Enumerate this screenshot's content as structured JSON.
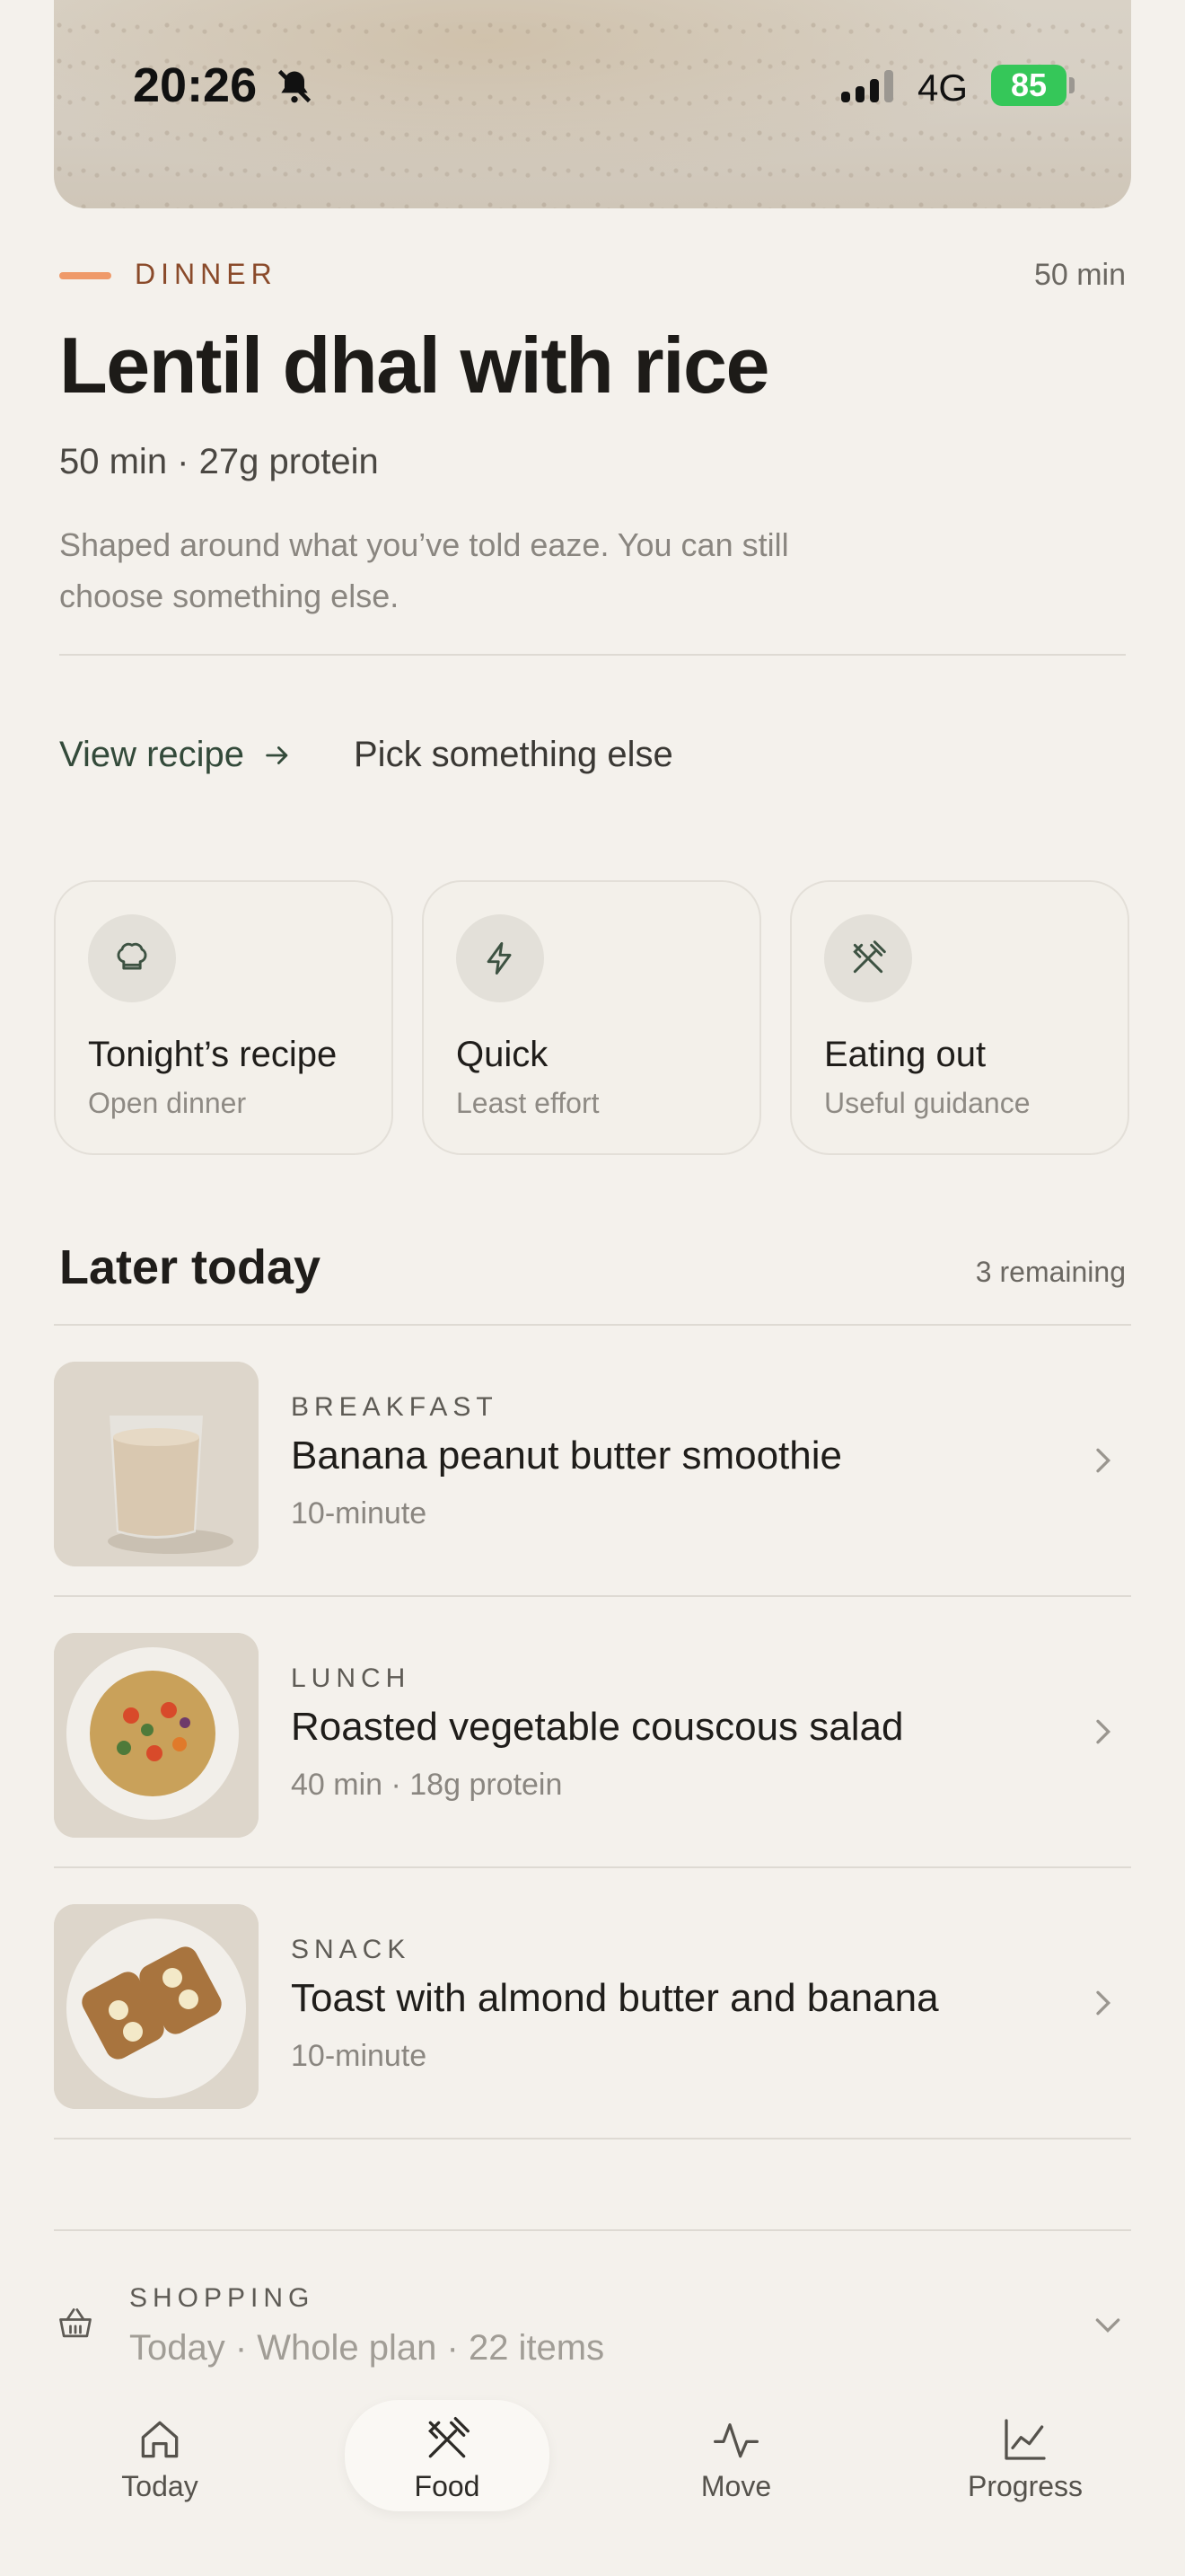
{
  "status_bar": {
    "time": "20:26",
    "network": "4G",
    "battery": "85"
  },
  "dinner": {
    "meal_type": "DINNER",
    "time": "50 min",
    "title": "Lentil dhal with rice",
    "subtitle": "50 min · 27g protein",
    "description": "Shaped around what you’ve told eaze. You can still choose something else.",
    "view_recipe_label": "View recipe",
    "pick_else_label": "Pick something else"
  },
  "cards": [
    {
      "title": "Tonight’s recipe",
      "subtitle": "Open dinner",
      "icon": "chef-hat-icon"
    },
    {
      "title": "Quick",
      "subtitle": "Least effort",
      "icon": "lightning-icon"
    },
    {
      "title": "Eating out",
      "subtitle": "Useful guidance",
      "icon": "utensils-icon"
    }
  ],
  "later": {
    "title": "Later today",
    "count": "3 remaining",
    "items": [
      {
        "category": "BREAKFAST",
        "name": "Banana peanut butter smoothie",
        "meta": "10-minute"
      },
      {
        "category": "LUNCH",
        "name": "Roasted vegetable couscous salad",
        "meta": "40 min · 18g protein"
      },
      {
        "category": "SNACK",
        "name": "Toast with almond butter and banana",
        "meta": "10-minute"
      }
    ]
  },
  "shopping": {
    "label": "SHOPPING",
    "meta": "Today · Whole plan · 22 items"
  },
  "tabs": [
    {
      "label": "Today",
      "icon": "home-icon",
      "active": false
    },
    {
      "label": "Food",
      "icon": "utensils-icon",
      "active": true
    },
    {
      "label": "Move",
      "icon": "pulse-icon",
      "active": false
    },
    {
      "label": "Progress",
      "icon": "chart-icon",
      "active": false
    }
  ],
  "colors": {
    "background": "#f4f1ec",
    "accent_dash": "#ef9a6a",
    "meal_label": "#8a4a2a",
    "link_green": "#334a3a",
    "battery_green": "#35c759"
  }
}
